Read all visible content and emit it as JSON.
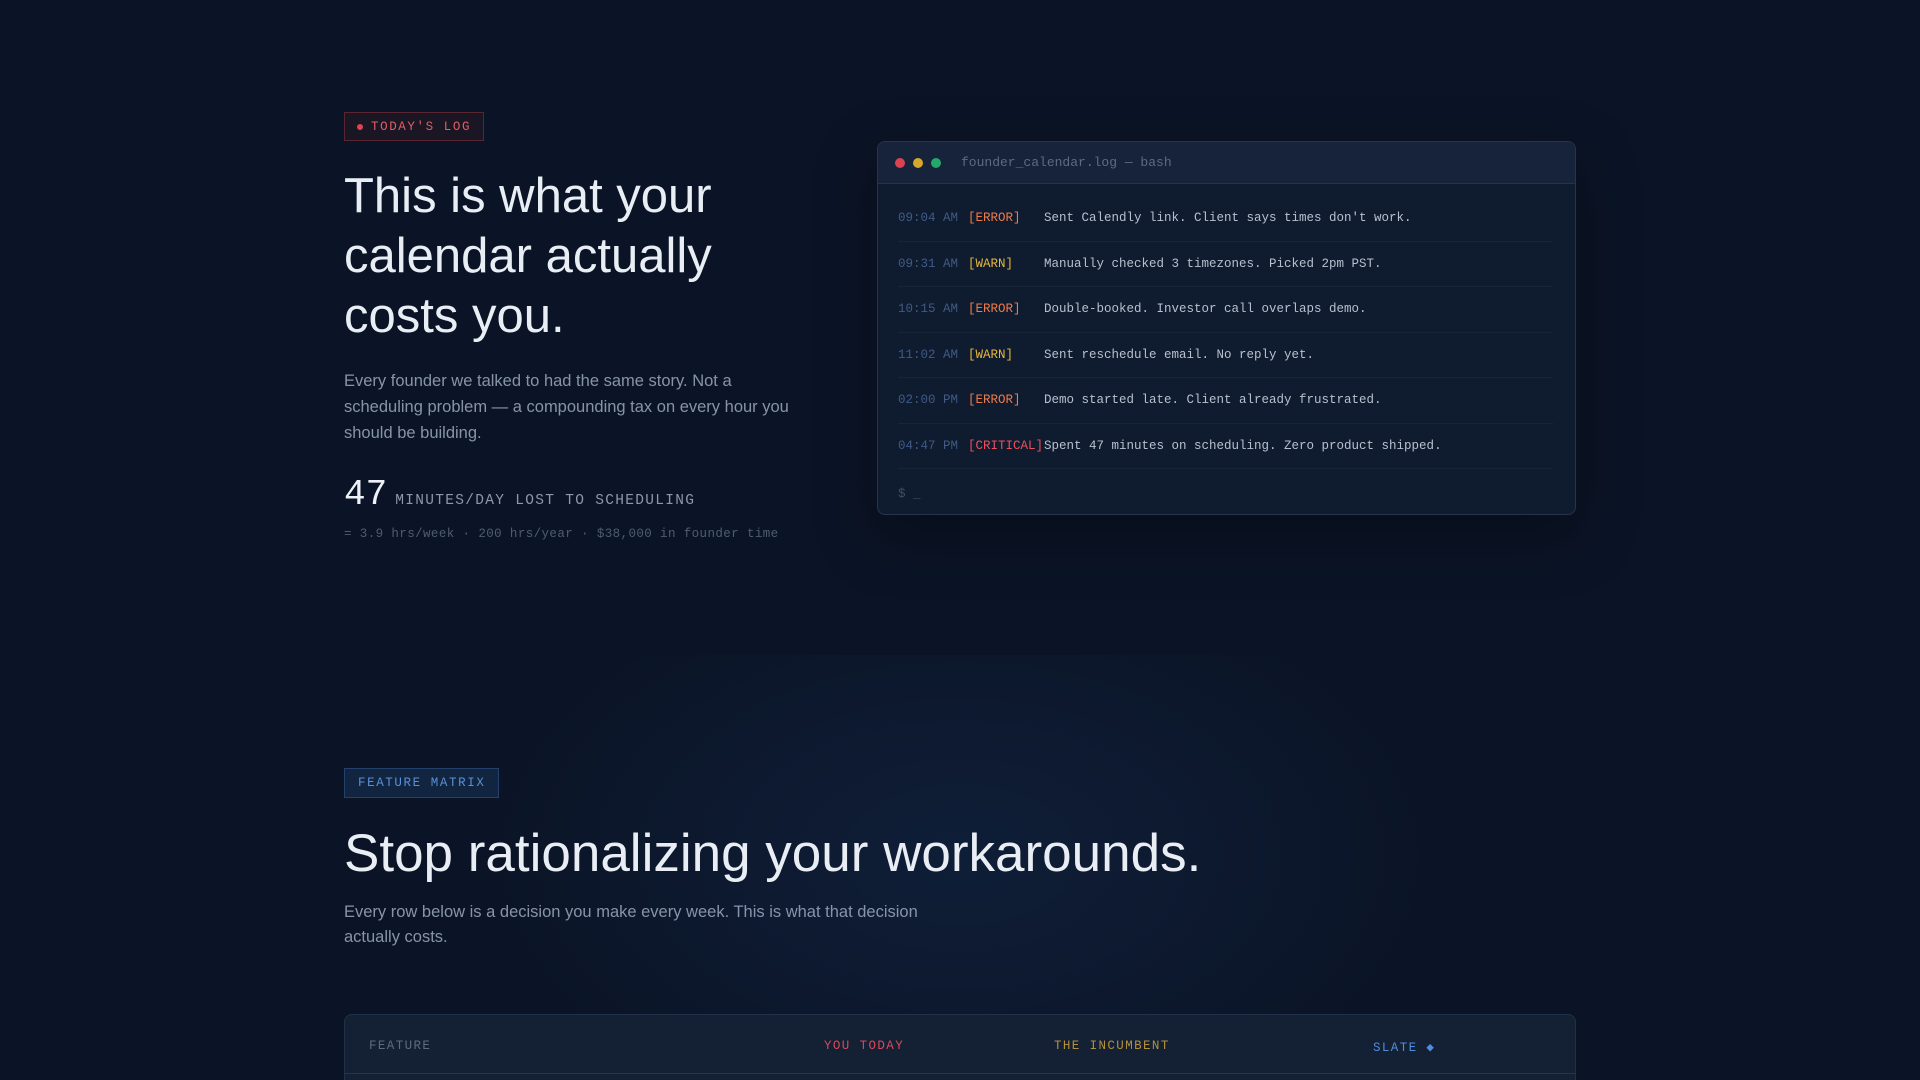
{
  "hero": {
    "badge": "TODAY'S LOG",
    "title": "This is what your calendar actually costs you.",
    "description": "Every founder we talked to had the same story. Not a scheduling problem — a compounding tax on every hour you should be building.",
    "stat_number": "47",
    "stat_label": "MINUTES/DAY LOST TO SCHEDULING",
    "stat_sub": "= 3.9 hrs/week · 200 hrs/year · $38,000 in founder time"
  },
  "terminal": {
    "title": "founder_calendar.log — bash",
    "lines": [
      {
        "time": "09:04 AM",
        "level": "[ERROR]",
        "message": "Sent Calendly link. Client says times don't work."
      },
      {
        "time": "09:31 AM",
        "level": "[WARN]",
        "message": "Manually checked 3 timezones. Picked 2pm PST."
      },
      {
        "time": "10:15 AM",
        "level": "[ERROR]",
        "message": "Double-booked. Investor call overlaps demo."
      },
      {
        "time": "11:02 AM",
        "level": "[WARN]",
        "message": "Sent reschedule email. No reply yet."
      },
      {
        "time": "02:00 PM",
        "level": "[ERROR]",
        "message": "Demo started late. Client already frustrated."
      },
      {
        "time": "04:47 PM",
        "level": "[CRITICAL]",
        "message": "Spent 47 minutes on scheduling. Zero product shipped."
      }
    ],
    "prompt": "$ _"
  },
  "feature_matrix": {
    "badge": "FEATURE MATRIX",
    "title": "Stop rationalizing your workarounds.",
    "description": "Every row below is a decision you make every week. This is what that decision actually costs.",
    "columns": {
      "feature": "FEATURE",
      "you_today": "YOU TODAY",
      "incumbent": "THE INCUMBENT",
      "slate": "SLATE ◆"
    }
  },
  "colors": {
    "background": "#0b1426",
    "error": "#f07b4a",
    "warn": "#e8b73a",
    "critical": "#ee4f5c",
    "accent_blue": "#4f8de0"
  }
}
